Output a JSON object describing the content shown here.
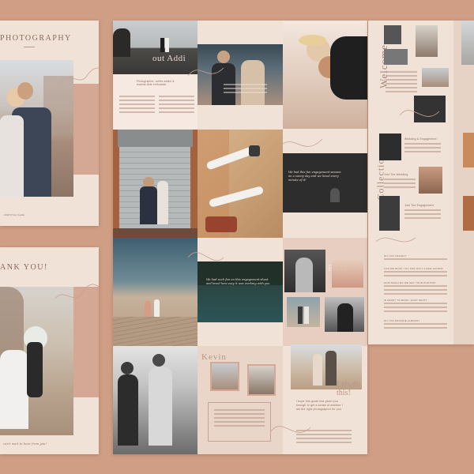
{
  "left_top": {
    "title": "PHOTOGRAPHY",
    "footer": "2020 Price Guide"
  },
  "left_bottom": {
    "title": "ANK YOU!",
    "footer": "can't wait to hear from you!"
  },
  "spread": {
    "about_heading": "out Addi",
    "about_subtitle": "Photographer, coffee addict & matcha latte enthusiast",
    "quote_1": "We had this fun engagement session on a sunny day and we loved every minute of it!",
    "quote_2": "We had such fun on this engagement shoot and loved how easy it was working with you",
    "faq_heading": "FAQ",
    "kevin_heading": "Kevin",
    "letsdo_heading": "Lets do\nthis!",
    "letsdo_body": "I hope this guide has given you enough to get a sense of whether I am the right photographer for you"
  },
  "right_page": {
    "welcome": "Welcome",
    "collection": "Collection",
    "wedding_label": "Wedding & Engagement",
    "just_wedding_label": "Just The Wedding",
    "just_engagement_label": "Just The Engagement",
    "faq_items": [
      "DO YOU TRAVEL?",
      "CAN WE BOOK YOU FOR ONLY A FEW HOURS?",
      "HOW MUCH DO WE GET YOUR PHOTOS?",
      "IS READY TO BOOK, WHAT NEXT?",
      "DO YOU PROVIDE ALBUMS?"
    ]
  },
  "colors": {
    "background": "#cf9e85",
    "paper": "#f1e2d8",
    "accent": "#d4a895",
    "ink": "#8a6a5a"
  }
}
